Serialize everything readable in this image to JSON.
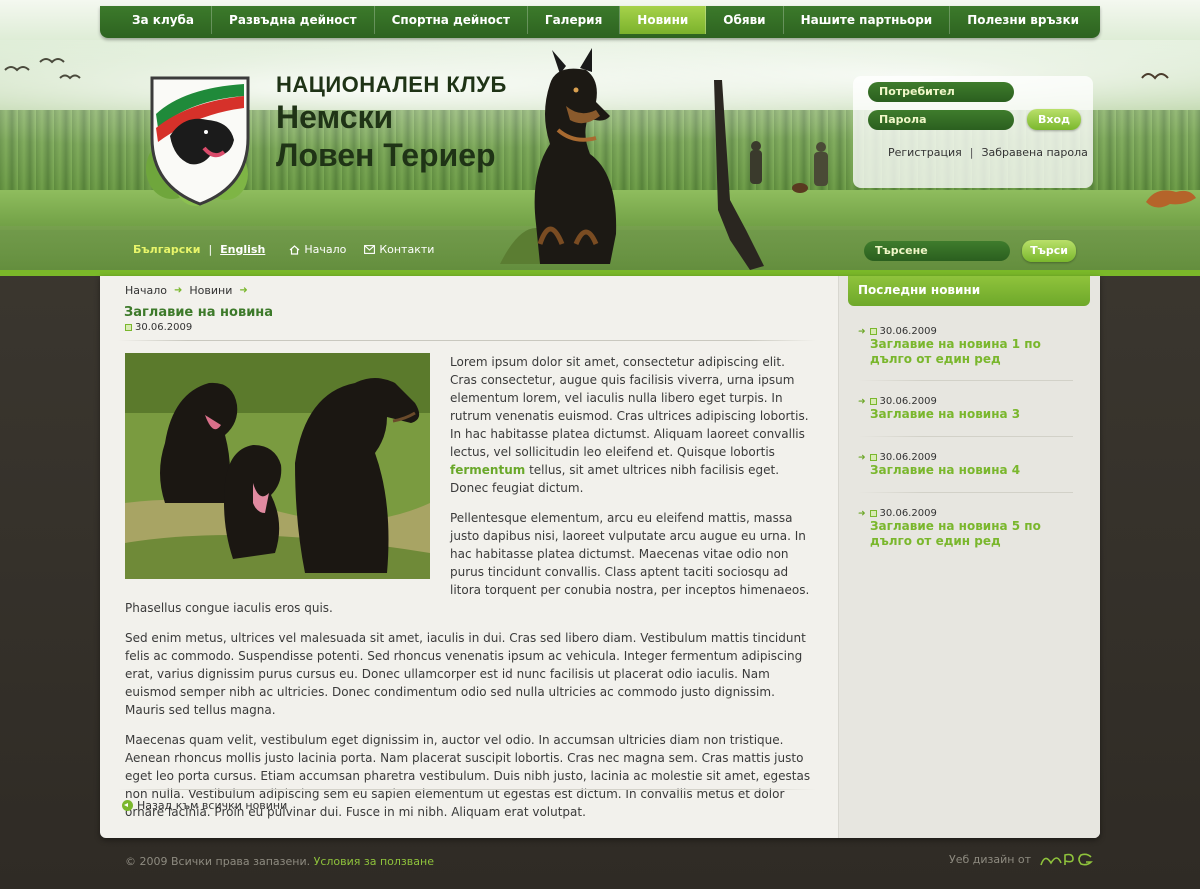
{
  "nav": {
    "items": [
      {
        "label": "За клуба",
        "active": false
      },
      {
        "label": "Развъдна дейност",
        "active": false
      },
      {
        "label": "Спортна дейност",
        "active": false
      },
      {
        "label": "Галерия",
        "active": false
      },
      {
        "label": "Новини",
        "active": true
      },
      {
        "label": "Обяви",
        "active": false
      },
      {
        "label": "Нашите партньори",
        "active": false
      },
      {
        "label": "Полезни връзки",
        "active": false
      }
    ]
  },
  "logo": {
    "line1": "НАЦИОНАЛЕН КЛУБ",
    "line2": "Немски",
    "line3": "Ловен Териер"
  },
  "login": {
    "user_placeholder": "Потребител",
    "password_placeholder": "Парола",
    "submit_label": "Вход",
    "register_label": "Регистрация",
    "separator": "|",
    "forgot_label": "Забравена парола"
  },
  "lang": {
    "bg": "Български",
    "separator": "|",
    "en": "English"
  },
  "quick_links": {
    "home": "Начало",
    "contacts": "Контакти"
  },
  "search": {
    "placeholder": "Търсене",
    "button_label": "Търси"
  },
  "breadcrumb": {
    "home": "Начало",
    "news": "Новини"
  },
  "article": {
    "title": "Заглавие на новина",
    "date": "30.06.2009",
    "p1_before": "Lorem ipsum dolor sit amet, consectetur adipiscing elit. Cras consectetur, augue quis facilisis viverra, urna ipsum elementum lorem, vel iaculis nulla libero eget turpis. In rutrum venenatis euismod. Cras ultrices adipiscing lobortis. In hac habitasse platea dictumst. Aliquam laoreet convallis lectus, vel sollicitudin leo eleifend et. Quisque lobortis ",
    "p1_highlight": "fermentum",
    "p1_after": " tellus, sit amet ultrices nibh facilisis eget. Donec feugiat dictum.",
    "p2": "Pellentesque elementum, arcu eu eleifend mattis, massa justo dapibus nisi, laoreet vulputate arcu augue eu urna. In hac habitasse platea dictumst. Maecenas vitae odio non purus tincidunt convallis. Class aptent taciti sociosqu ad litora torquent per conubia nostra, per inceptos himenaeos. Phasellus congue iaculis eros quis.",
    "p3": "Sed enim metus, ultrices vel malesuada sit amet, iaculis in dui. Cras sed libero diam. Vestibulum mattis tincidunt felis ac commodo. Suspendisse potenti. Sed rhoncus venenatis ipsum ac vehicula. Integer fermentum adipiscing erat, varius dignissim purus cursus eu. Donec ullamcorper est id nunc facilisis ut placerat odio iaculis. Nam euismod semper nibh ac ultricies. Donec condimentum odio sed nulla ultricies ac commodo justo dignissim. Mauris sed tellus magna.",
    "p4": "Maecenas quam velit, vestibulum eget dignissim in, auctor vel odio. In accumsan ultricies diam non tristique. Aenean rhoncus mollis justo lacinia porta. Nam placerat suscipit lobortis. Cras nec magna sem. Cras mattis justo eget leo porta cursus. Etiam accumsan pharetra vestibulum. Duis nibh justo, lacinia ac molestie sit amet, egestas non nulla. Vestibulum adipiscing sem eu sapien elementum ut egestas est dictum. In convallis metus et dolor ornare lacinia. Proin eu pulvinar dui. Fusce in mi nibh. Aliquam erat volutpat.",
    "back_label": "Назад към всички новини"
  },
  "sidebar": {
    "title": "Последни новини",
    "news": [
      {
        "date": "30.06.2009",
        "title": "Заглавие на новина 1 по дълго от един ред"
      },
      {
        "date": "30.06.2009",
        "title": "Заглавие на новина 3"
      },
      {
        "date": "30.06.2009",
        "title": "Заглавие на новина 4"
      },
      {
        "date": "30.06.2009",
        "title": "Заглавие на новина 5 по дълго от един ред"
      }
    ]
  },
  "footer": {
    "copyright": "© 2009 Всички права запазени.",
    "terms": "Условия за ползване",
    "design_by": "Уеб дизайн от",
    "designer_logo": "MPG"
  },
  "colors": {
    "nav_green": "#2d6320",
    "accent_green": "#7ab72d",
    "title_green": "#3d7a2a",
    "panel_bg": "#f2f1ec",
    "page_bg": "#3f3b33"
  }
}
